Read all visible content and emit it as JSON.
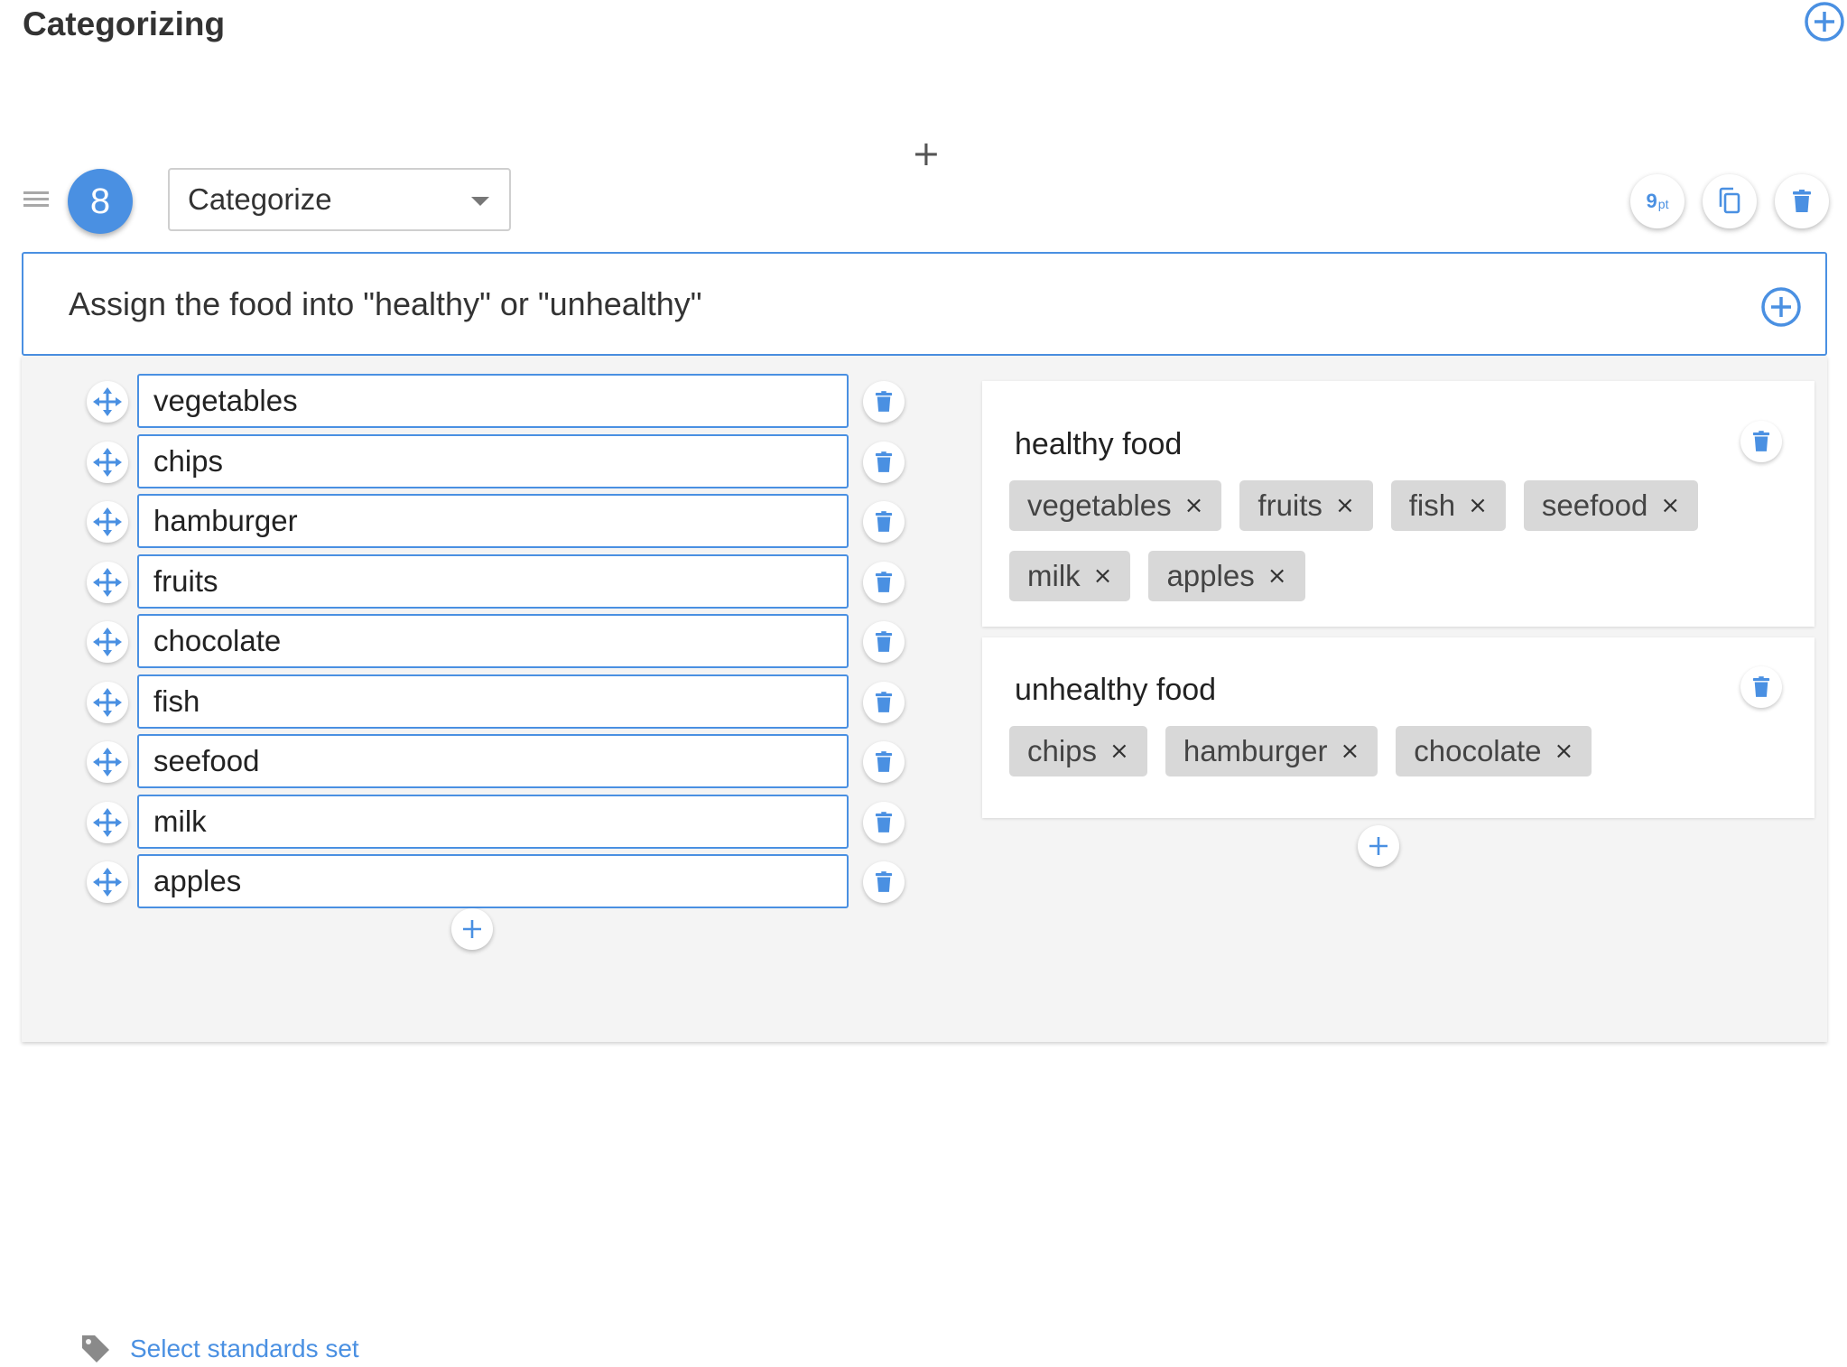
{
  "page": {
    "title": "Categorizing"
  },
  "toolbar": {
    "insert_symbol": "+"
  },
  "question": {
    "number": "8",
    "type_select": "Categorize",
    "points_value": "9",
    "points_unit": "pt",
    "prompt": "Assign the food into \"healthy\" or \"unhealthy\""
  },
  "items": [
    "vegetables",
    "chips",
    "hamburger",
    "fruits",
    "chocolate",
    "fish",
    "seefood",
    "milk",
    "apples"
  ],
  "categories": [
    {
      "title": "healthy food",
      "chips": [
        "vegetables",
        "fruits",
        "fish",
        "seefood",
        "milk",
        "apples"
      ]
    },
    {
      "title": "unhealthy food",
      "chips": [
        "chips",
        "hamburger",
        "chocolate"
      ]
    }
  ],
  "standards": {
    "link_label": "Select standards set"
  },
  "icons": {
    "drag": "drag-handle-icon",
    "move": "move-arrows-icon",
    "trash": "trash-icon",
    "copy": "copy-icon",
    "add": "plus-icon",
    "tag": "tag-icon",
    "remove": "close-icon"
  },
  "colors": {
    "accent": "#4a90e2",
    "chip_bg": "#d8d8d8",
    "panel_bg": "#f4f4f4"
  }
}
